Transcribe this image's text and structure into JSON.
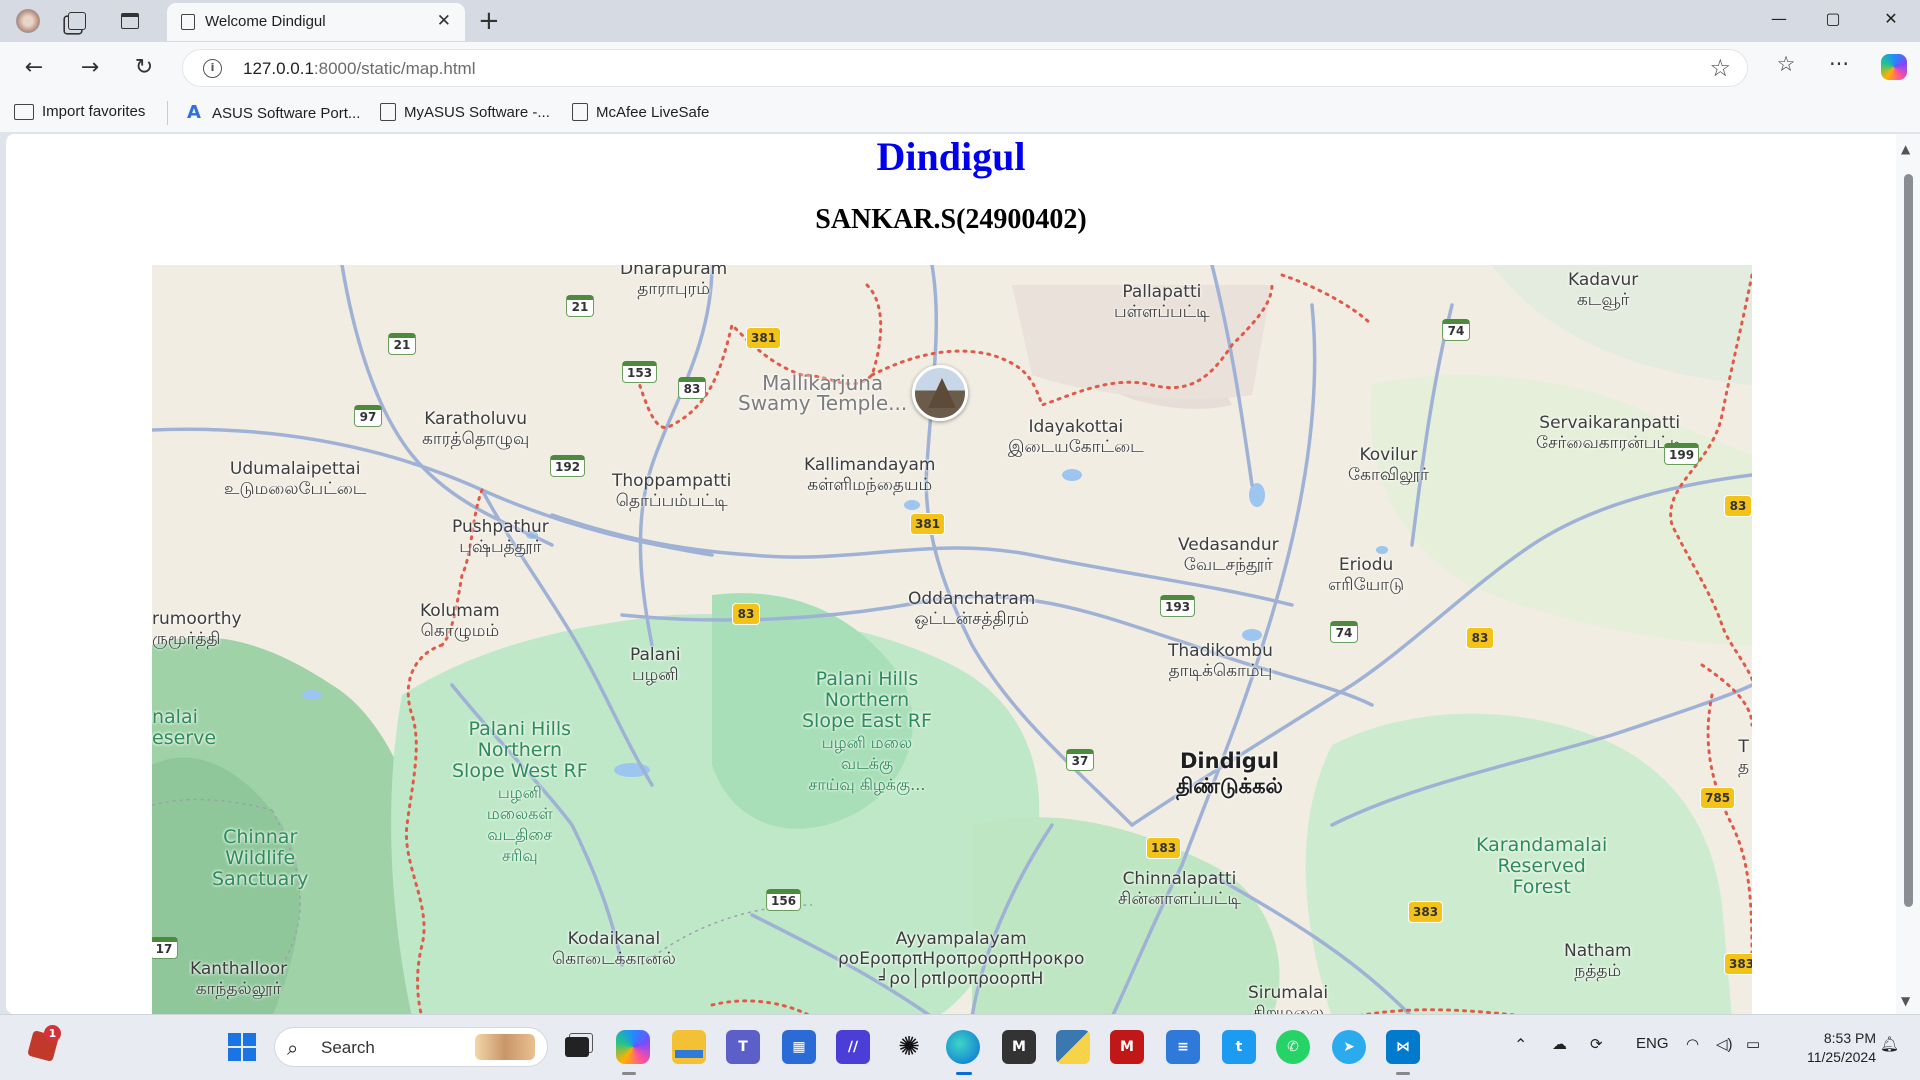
{
  "browser": {
    "tab_title": "Welcome Dindigul",
    "url_host": "127.0.0.1",
    "url_rest": ":8000/static/map.html",
    "window_controls": {
      "minimize": "—",
      "maximize": "▢",
      "close": "✕"
    }
  },
  "bookmarks": [
    {
      "label": "Import favorites",
      "icon": "import-icon"
    },
    {
      "label": "ASUS Software Port...",
      "icon": "asus-icon"
    },
    {
      "label": "MyASUS Software -...",
      "icon": "page-icon"
    },
    {
      "label": "McAfee LiveSafe",
      "icon": "page-icon"
    }
  ],
  "page": {
    "heading": "Dindigul",
    "subheading": "SANKAR.S(24900402)"
  },
  "map": {
    "labels": {
      "dharapuram": "Dharapuram",
      "dharapuram_ta": "தாராபுரம்",
      "pallapatti": "Pallapatti",
      "pallapatti_ta": "பள்ளப்பட்டி",
      "kadavur": "Kadavur",
      "kadavur_ta": "கடவூர்",
      "mallikarjuna_1": "Mallikarjuna",
      "mallikarjuna_2": "Swamy Temple...",
      "karatholuvu": "Karatholuvu",
      "karatholuvu_ta": "காரத்தொழுவு",
      "idayakottai": "Idayakottai",
      "idayakottai_ta": "இடையகோட்டை",
      "servaikaranpatti": "Servaikaranpatti",
      "servaikaranpatti_ta": "சேர்வைகாரன்பட்டி",
      "kovilur": "Kovilur",
      "kovilur_ta": "கோவிலூர்",
      "udumalaipettai": "Udumalaipettai",
      "udumalaipettai_ta": "உடுமலைபேட்டை",
      "thoppampatti": "Thoppampatti",
      "thoppampatti_ta": "தொப்பம்பட்டி",
      "kallimandayam": "Kallimandayam",
      "kallimandayam_ta": "கள்ளிமந்தையம்",
      "pushpathur": "Pushpathur",
      "pushpathur_ta": "புஷ்பத்தூர்",
      "vedasandur": "Vedasandur",
      "vedasandur_ta": "வேடசந்தூர்",
      "eriodu": "Eriodu",
      "eriodu_ta": "எரியோடு",
      "murthy": "rumoorthy",
      "murthy_ta": "ருமூர்த்தி",
      "oddanchatram": "Oddanchatram",
      "oddanchatram_ta": "ஒட்டன்சத்திரம்",
      "kolumam": "Kolumam",
      "kolumam_ta": "கொழுமம்",
      "thadikombu": "Thadikombu",
      "thadikombu_ta": "தாடிக்கொம்பு",
      "palani": "Palani",
      "palani_ta": "பழனி",
      "palani_east_1": "Palani Hills",
      "palani_east_2": "Northern",
      "palani_east_3": "Slope East RF",
      "palani_east_ta_1": "பழனி மலை",
      "palani_east_ta_2": "வடக்கு",
      "palani_east_ta_3": "சாய்வு கிழக்கு...",
      "anamalai_1": "nalai",
      "anamalai_2": "eserve",
      "palani_west_1": "Palani Hills",
      "palani_west_2": "Northern",
      "palani_west_3": "Slope West RF",
      "palani_west_ta_1": "பழனி",
      "palani_west_ta_2": "மலைகள்",
      "palani_west_ta_3": "வடதிசை",
      "palani_west_ta_4": "சரிவு",
      "dindigul": "Dindigul",
      "dindigul_ta": "திண்டுக்கல்",
      "chinnar_1": "Chinnar",
      "chinnar_2": "Wildlife",
      "chinnar_3": "Sanctuary",
      "karandamalai_1": "Karandamalai",
      "karandamalai_2": "Reserved",
      "karandamalai_3": "Forest",
      "chinnalapatti": "Chinnalapatti",
      "chinnalapatti_ta": "சின்னாளப்பட்டி",
      "kodaikanal": "Kodaikanal",
      "kodaikanal_ta": "கொடைக்கானல்",
      "ayyampalayam": "Ayyampalayam",
      "ayyampalayam_ta_1": "ρoEροπρπΗροπροορπΗροκρο",
      "ayyampalayam_ta_2": "╛ρο│ρπΙροπροορπΗ",
      "natham": "Natham",
      "natham_ta": "நத்தம்",
      "kanthalloor": "Kanthalloor",
      "kanthalloor_ta": "காந்தல்லூர்",
      "sirumalai": "Sirumalai",
      "sirumalai_ta": "சிறுமலை",
      "edge_t": "T",
      "edge_ta": "த"
    },
    "shields": {
      "r21a": "21",
      "r21b": "21",
      "r381a": "381",
      "r153": "153",
      "r83a": "83",
      "r74a": "74",
      "r97": "97",
      "r192": "192",
      "r381b": "381",
      "r199": "199",
      "r83b": "83",
      "r83c": "83",
      "r193": "193",
      "r74b": "74",
      "r83d": "83",
      "r37": "37",
      "r785": "785",
      "r183": "183",
      "r383a": "383",
      "r156": "156",
      "r17": "17",
      "r383b": "383"
    }
  },
  "taskbar": {
    "search_placeholder": "Search",
    "notification_count": "1",
    "lang": "ENG",
    "time": "8:53 PM",
    "date": "11/25/2024",
    "apps": [
      "windows-start",
      "search",
      "task-view",
      "copilot",
      "file-explorer",
      "teams",
      "microsoft-store",
      "visual-studio",
      "chatgpt",
      "edge",
      "mendeley",
      "python",
      "mcafee",
      "notepad",
      "twitter",
      "whatsapp",
      "telegram",
      "vscode"
    ]
  }
}
